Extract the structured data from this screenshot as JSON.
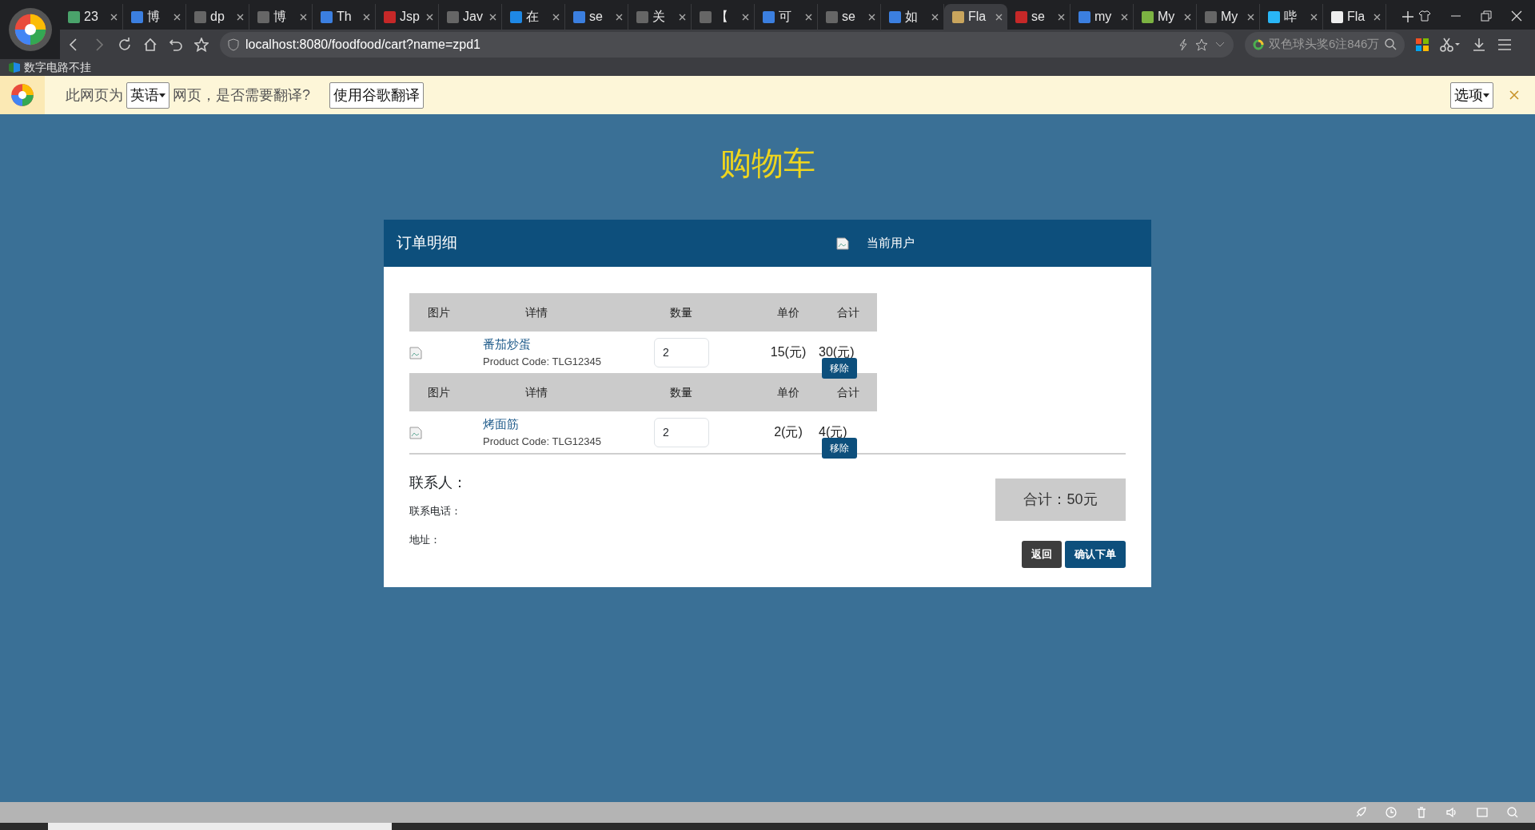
{
  "browser": {
    "tabs": [
      {
        "label": "23",
        "selected": false
      },
      {
        "label": "博",
        "selected": false
      },
      {
        "label": "dp",
        "selected": false
      },
      {
        "label": "博",
        "selected": false
      },
      {
        "label": "Th",
        "selected": false
      },
      {
        "label": "Jsp",
        "selected": false
      },
      {
        "label": "Jav",
        "selected": false
      },
      {
        "label": "在",
        "selected": false
      },
      {
        "label": "se",
        "selected": false
      },
      {
        "label": "关",
        "selected": false
      },
      {
        "label": "【",
        "selected": false
      },
      {
        "label": "可",
        "selected": false
      },
      {
        "label": "se",
        "selected": false
      },
      {
        "label": "如",
        "selected": false
      },
      {
        "label": "Fla",
        "selected": true
      },
      {
        "label": "se",
        "selected": false
      },
      {
        "label": "my",
        "selected": false
      },
      {
        "label": "My",
        "selected": false
      },
      {
        "label": "My",
        "selected": false
      },
      {
        "label": "哔",
        "selected": false
      },
      {
        "label": "Fla",
        "selected": false
      }
    ],
    "address": "localhost:8080/foodfood/cart?name=zpd1",
    "search_box": {
      "value": "双色球头奖6注846万"
    },
    "bookmarks": [
      "数字电路不挂"
    ]
  },
  "translate_bar": {
    "prefix": "此网页为",
    "language": "英语",
    "suffix": "网页，是否需要翻译?",
    "translate_button": "使用谷歌翻译",
    "options_button": "选项"
  },
  "page": {
    "title": "购物车",
    "card": {
      "title": "订单明细",
      "user_label": "当前用户",
      "items": [
        {
          "columns": [
            "图片",
            "详情",
            "数量",
            "单价",
            "合计"
          ],
          "name": "番茄炒蛋",
          "code": "Product Code: TLG12345",
          "quantity": "2",
          "unit_price": "15(元)",
          "subtotal": "30(元)",
          "remove_button": "移除"
        },
        {
          "columns": [
            "图片",
            "详情",
            "数量",
            "单价",
            "合计"
          ],
          "name": "烤面筋",
          "code": "Product Code: TLG12345",
          "quantity": "2",
          "unit_price": "2(元)",
          "subtotal": "4(元)",
          "remove_button": "移除"
        }
      ],
      "contact": {
        "name_label": "联系人：",
        "phone_label": "联系电话：",
        "address_label": "地址："
      },
      "total": "合计：50元",
      "buttons": [
        {
          "label": "返回",
          "kind": "secondary"
        },
        {
          "label": "确认下单",
          "kind": "primary"
        }
      ]
    }
  }
}
